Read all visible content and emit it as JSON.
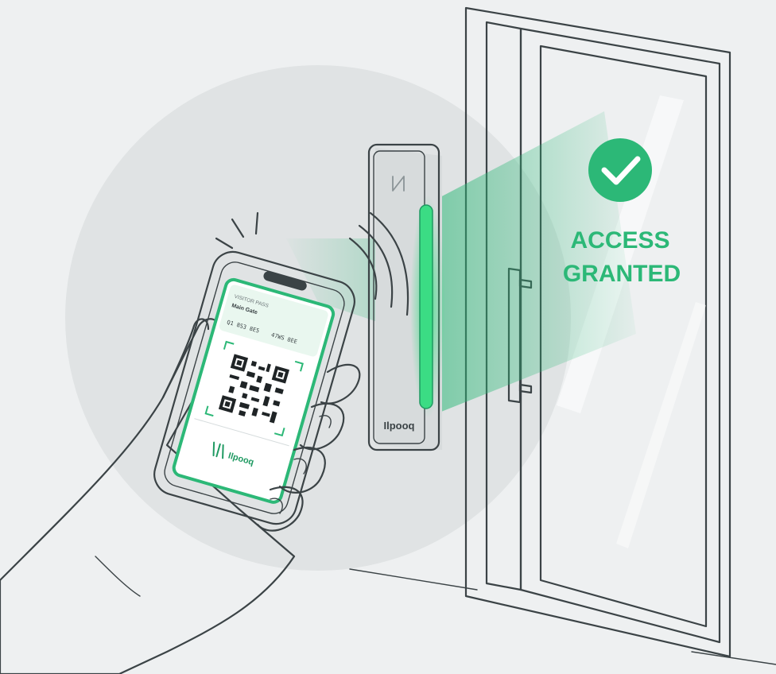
{
  "colors": {
    "background": "#eef0f1",
    "halo": "#e0e3e4",
    "accent": "#2cb877",
    "accent_dark": "#1f9a62",
    "accent_light": "#c9ecd9",
    "reader_led": "#3bdc84",
    "glass": "#e8eced",
    "line": "#3b4346"
  },
  "status": {
    "line1": "ACCESS",
    "line2": "GRANTED",
    "icon": "check-circle-icon"
  },
  "reader": {
    "brand": "Ilpooq",
    "icon": "nfc-icon"
  },
  "phone": {
    "ticket": {
      "line1": "VISITOR PASS",
      "line2": "Main Gate",
      "line3": "Q1 8S3 8E5",
      "line4": "47WS 8EE",
      "brand": "Ilpooq",
      "logo": "brand-logo-icon",
      "code": "qr-code-icon"
    }
  },
  "icons": {
    "wireless": "wireless-waves-icon",
    "vibration": "vibration-lines-icon",
    "handle": "door-handle-icon"
  }
}
